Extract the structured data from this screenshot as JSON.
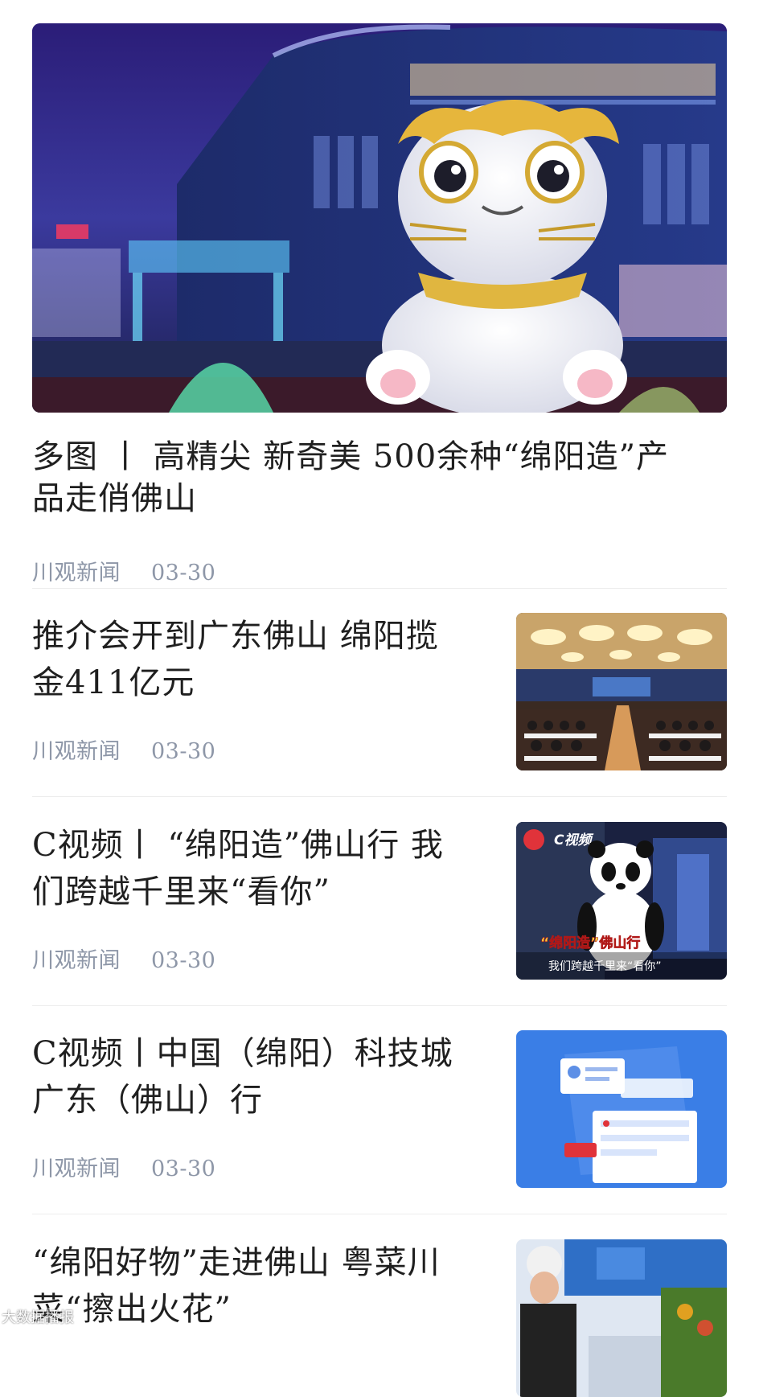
{
  "featured": {
    "title": "多图 丨 高精尖 新奇美 500余种“绵阳造”产品走俏佛山",
    "source": "川观新闻",
    "date": "03-30",
    "image_icon": "hero-photo-mascot-night-mall"
  },
  "items": [
    {
      "title": "推介会开到广东佛山 绵阳揽金411亿元",
      "source": "川观新闻",
      "date": "03-30",
      "thumb_icon": "conference-hall-photo"
    },
    {
      "title": "C视频丨 “绵阳造”佛山行 我们跨越千里来“看你”",
      "source": "川观新闻",
      "date": "03-30",
      "thumb_icon": "panda-mascot-video-thumb",
      "thumb_badge": "C视频",
      "thumb_caption_1": "“绵阳造”佛山行",
      "thumb_caption_2": "我们跨越千里来“看你”"
    },
    {
      "title": "C视频丨中国（绵阳）科技城广东（佛山）行",
      "source": "川观新闻",
      "date": "03-30",
      "thumb_icon": "blue-placeholder-illustration"
    },
    {
      "title": "“绵阳好物”走进佛山 粤菜川菜“擦出火花”",
      "source": "",
      "date": "",
      "thumb_icon": "chef-exhibition-photo"
    }
  ],
  "watermark": "大数据播报",
  "colors": {
    "meta": "#8e97a8",
    "title": "#1f1f1f",
    "divider": "#ececec",
    "thumb_blue": "#3a7ee6"
  }
}
